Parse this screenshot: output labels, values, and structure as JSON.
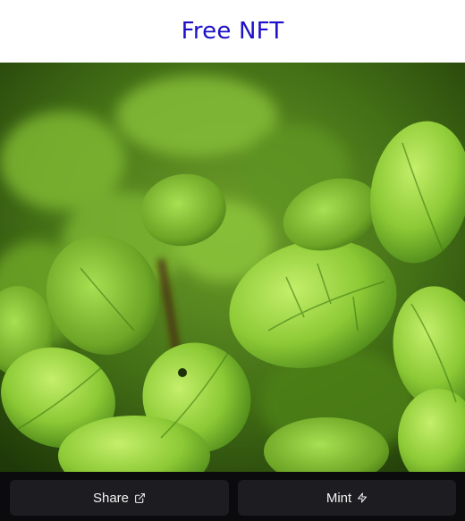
{
  "header": {
    "title": "Free NFT"
  },
  "nft": {
    "image_icon": "mint-plant-photo"
  },
  "footer": {
    "share_label": "Share",
    "share_icon": "external-link-icon",
    "mint_label": "Mint",
    "mint_icon": "lightning-bolt-icon"
  },
  "colors": {
    "title": "#1e10c8",
    "footer_bg": "#0b0b0d",
    "button_bg": "#1d1d21",
    "button_text": "#f2f2f2"
  }
}
